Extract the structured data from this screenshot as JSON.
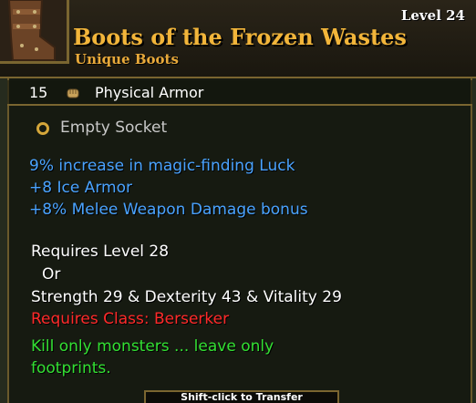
{
  "header": {
    "level_label": "Level 24",
    "item_name": "Boots of the Frozen Wastes",
    "item_type": "Unique Boots"
  },
  "armor": {
    "value": "15",
    "label": "Physical Armor"
  },
  "socket": {
    "label": "Empty Socket"
  },
  "bonuses": [
    "9% increase in magic-finding Luck",
    "+8 Ice Armor",
    "+8% Melee Weapon Damage bonus"
  ],
  "requirements": {
    "level": "Requires Level 28",
    "or": "Or",
    "stats": "Strength 29 & Dexterity 43 & Vitality 29",
    "class": "Requires Class: Berserker"
  },
  "flavor": {
    "line1": "Kill only monsters ... leave only",
    "line2": "footprints."
  },
  "footer": {
    "hint": "Shift-click to Transfer"
  },
  "colors": {
    "name_gold": "#f2b53a",
    "bonus_blue": "#4aa3ff",
    "requirement_red": "#ff2a2a",
    "flavor_green": "#33e033"
  }
}
